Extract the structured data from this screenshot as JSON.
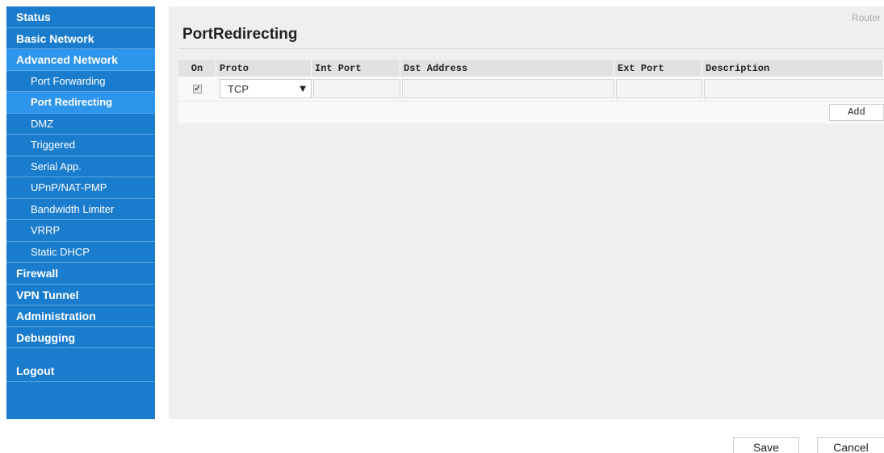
{
  "sidebar": {
    "items": [
      {
        "label": "Status"
      },
      {
        "label": "Basic Network"
      },
      {
        "label": "Advanced Network"
      },
      {
        "label": "Port Forwarding"
      },
      {
        "label": "Port Redirecting"
      },
      {
        "label": "DMZ"
      },
      {
        "label": "Triggered"
      },
      {
        "label": "Serial App."
      },
      {
        "label": "UPnP/NAT-PMP"
      },
      {
        "label": "Bandwidth Limiter"
      },
      {
        "label": "VRRP"
      },
      {
        "label": "Static DHCP"
      },
      {
        "label": "Firewall"
      },
      {
        "label": "VPN Tunnel"
      },
      {
        "label": "Administration"
      },
      {
        "label": "Debugging"
      },
      {
        "label": "Logout"
      }
    ],
    "active": "Port Redirecting"
  },
  "header": {
    "router_label": "Router",
    "title": "PortRedirecting"
  },
  "table": {
    "columns": [
      "On",
      "Proto",
      "Int Port",
      "Dst Address",
      "Ext Port",
      "Description"
    ],
    "edit_row": {
      "on_checked": true,
      "proto": "TCP",
      "int_port": "",
      "dst_address": "",
      "ext_port": "",
      "description": ""
    },
    "add_label": "Add"
  },
  "footer": {
    "save_label": "Save",
    "cancel_label": "Cancel"
  },
  "colors": {
    "sidebar_bg": "#1a7ccd",
    "sidebar_active": "#2d95eb",
    "panel_bg": "#efefef"
  }
}
